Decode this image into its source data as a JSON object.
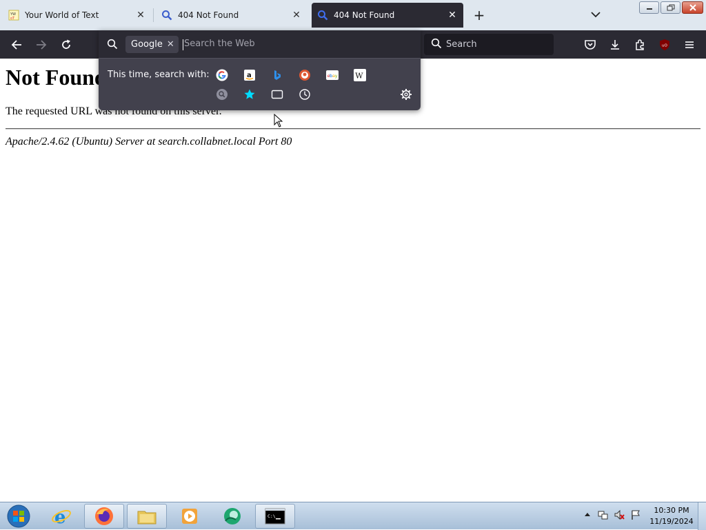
{
  "tabs": [
    {
      "title": "Your World of Text",
      "close": "✕",
      "favicon": "yourworldoftext-favicon",
      "active": false
    },
    {
      "title": "404 Not Found",
      "close": "✕",
      "favicon": "search-icon",
      "active": false
    },
    {
      "title": "404 Not Found",
      "close": "✕",
      "favicon": "search-icon",
      "active": true
    }
  ],
  "new_tab_glyph": "+",
  "toolbar": {
    "search_placeholder": "Search",
    "icons": [
      "back-icon",
      "forward-icon",
      "reload-icon",
      "pocket-icon",
      "downloads-icon",
      "extensions-icon",
      "ublock-icon",
      "menu-icon"
    ]
  },
  "search_popup": {
    "engine": "Google",
    "engine_remove": "✕",
    "placeholder": "Search the Web",
    "this_time_label": "This time, search with:",
    "engines": [
      "google",
      "amazon",
      "bing",
      "duckduckgo",
      "ebay",
      "wikipedia"
    ],
    "modes": [
      "search-engines-icon",
      "bookmarks-icon",
      "tabs-icon",
      "history-icon"
    ]
  },
  "page": {
    "heading": "Not Found",
    "message": "The requested URL was not found on this server.",
    "address": "Apache/2.4.62 (Ubuntu) Server at search.collabnet.local Port 80"
  },
  "taskbar": {
    "time": "10:30 PM",
    "date": "11/19/2024",
    "apps": [
      "start-orb",
      "internet-explorer",
      "firefox",
      "file-explorer",
      "media-player",
      "app-green",
      "command-prompt"
    ]
  },
  "colors": {
    "toolbar_bg": "#2b2a33",
    "popup_bg": "#42414d",
    "accent_blue": "#0060df",
    "tabstrip_bg": "#dfe7ef"
  }
}
